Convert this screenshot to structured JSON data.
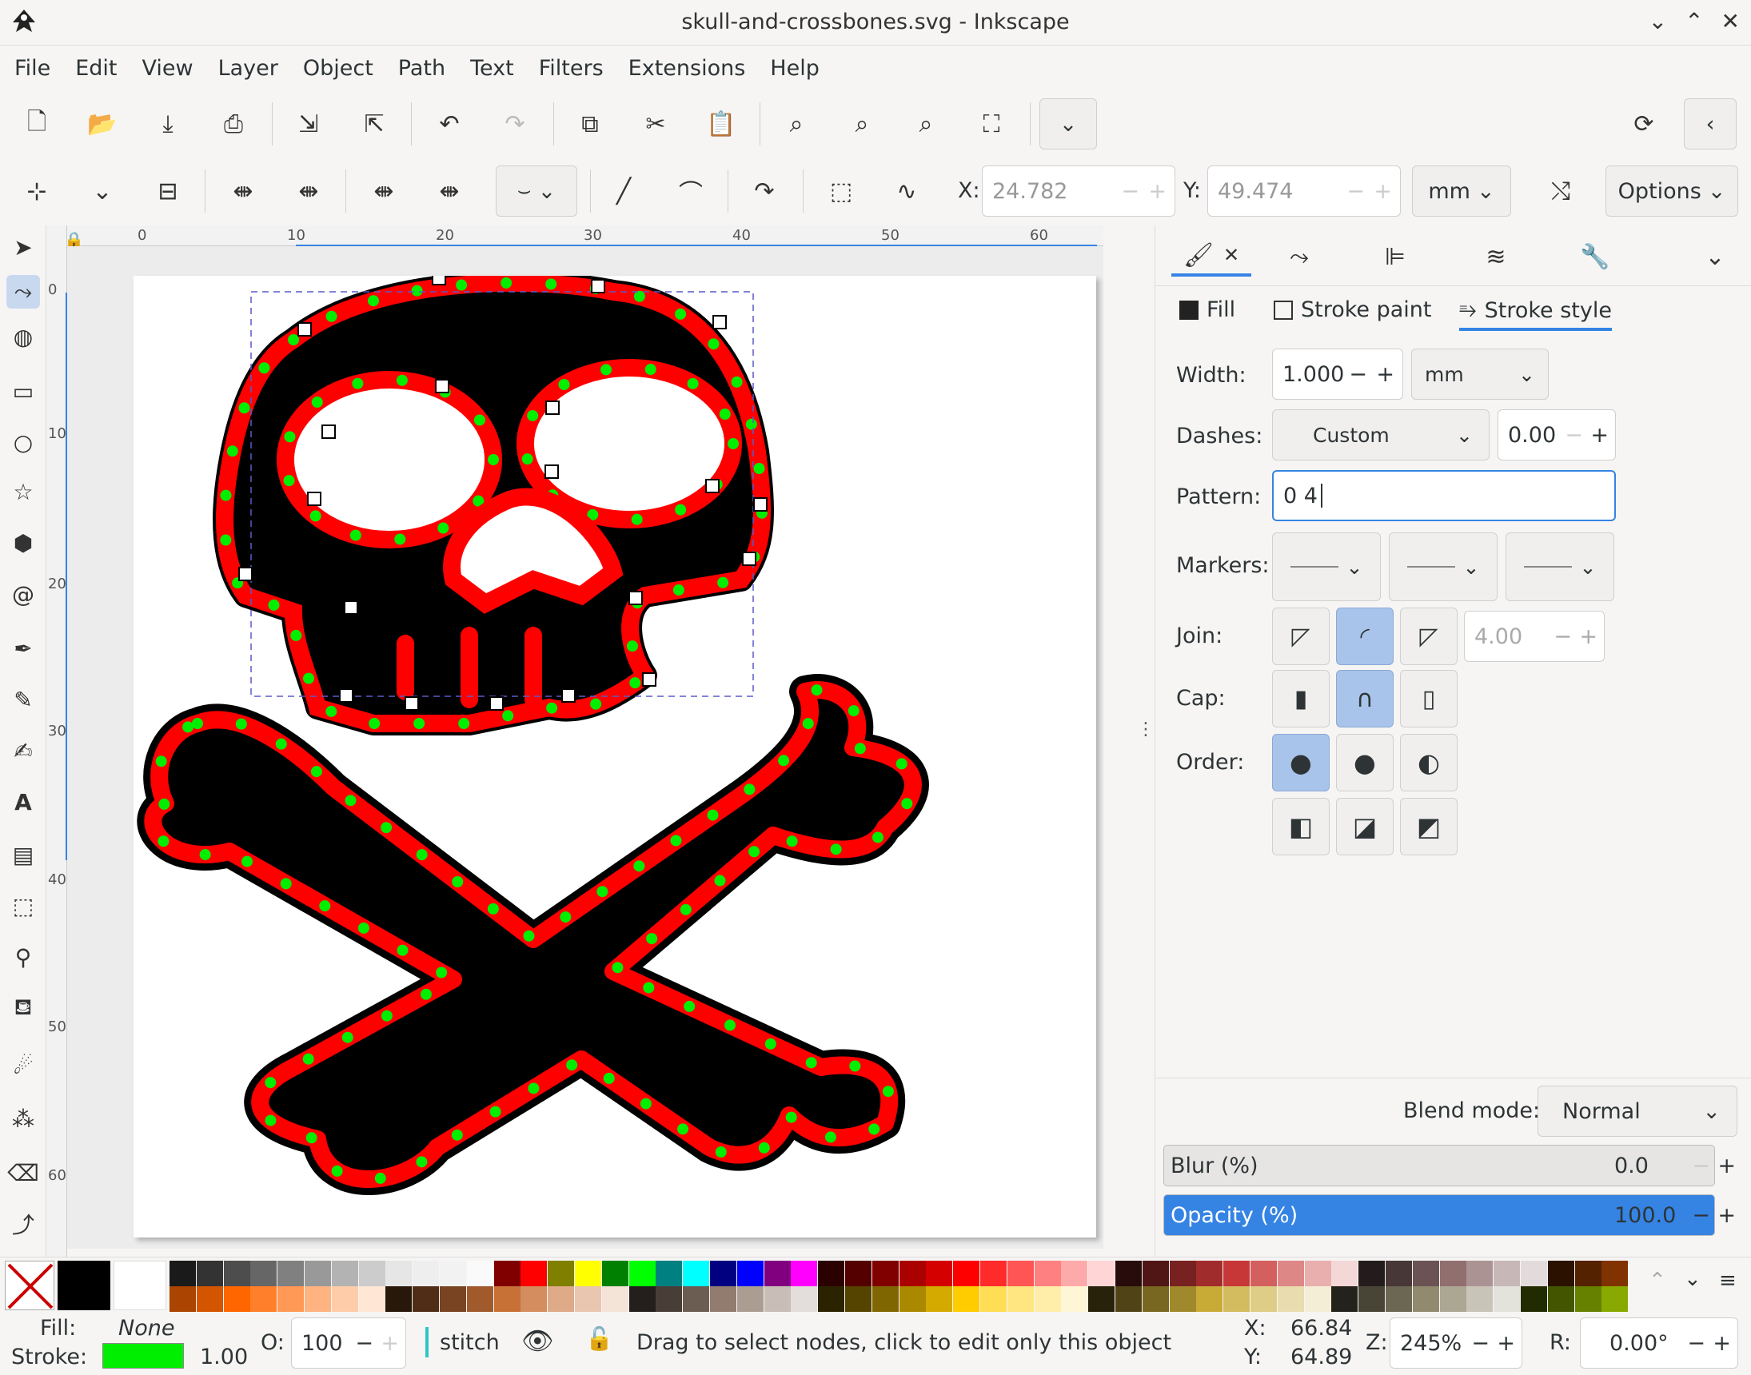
{
  "window": {
    "title": "skull-and-crossbones.svg - Inkscape"
  },
  "menu": [
    "File",
    "Edit",
    "View",
    "Layer",
    "Object",
    "Path",
    "Text",
    "Filters",
    "Extensions",
    "Help"
  ],
  "node_toolbar": {
    "x_label": "X:",
    "x_value": "24.782",
    "y_label": "Y:",
    "y_value": "49.474",
    "unit": "mm",
    "options_label": "Options"
  },
  "ruler": {
    "h_ticks": [
      "0",
      "10",
      "20",
      "30",
      "40",
      "50",
      "60"
    ],
    "v_ticks": [
      "0",
      "10",
      "20",
      "30",
      "40",
      "50",
      "60"
    ]
  },
  "panel": {
    "subtabs": {
      "fill": "Fill",
      "stroke_paint": "Stroke paint",
      "stroke_style": "Stroke style"
    },
    "width_label": "Width:",
    "width_value": "1.000",
    "width_unit": "mm",
    "dashes_label": "Dashes:",
    "dashes_value": "Custom",
    "dash_offset": "0.00",
    "pattern_label": "Pattern:",
    "pattern_value": "0 4",
    "markers_label": "Markers:",
    "join_label": "Join:",
    "miter_value": "4.00",
    "cap_label": "Cap:",
    "order_label": "Order:",
    "blend_label": "Blend mode:",
    "blend_value": "Normal",
    "blur_label": "Blur (%)",
    "blur_value": "0.0",
    "opacity_label": "Opacity (%)",
    "opacity_value": "100.0",
    "opacity_fraction": 1.0
  },
  "status": {
    "fill_label": "Fill:",
    "fill_value": "None",
    "stroke_label": "Stroke:",
    "stroke_width": "1.00",
    "stroke_color": "#00ee00",
    "o_label": "O:",
    "o_value": "100",
    "layer": "stitch",
    "message": "Drag to select nodes, click to edit only this object",
    "cx_label": "X:",
    "cx_value": "66.84",
    "cy_label": "Y:",
    "cy_value": "64.89",
    "z_label": "Z:",
    "zoom": "245%",
    "r_label": "R:",
    "rotation": "0.00°"
  },
  "colors": {
    "accent": "#3584e4",
    "stroke_red": "#ff0000",
    "dots_green": "#00ee00"
  }
}
